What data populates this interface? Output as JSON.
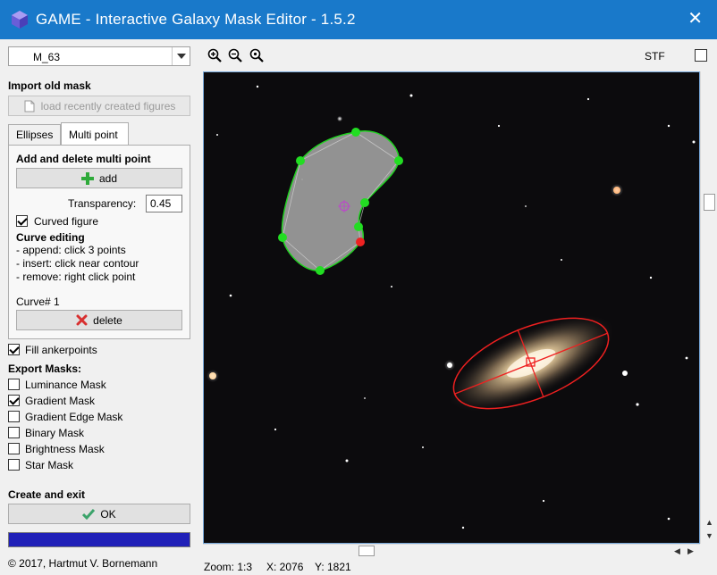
{
  "window": {
    "title": "GAME - Interactive Galaxy Mask Editor -  1.5.2",
    "close_glyph": "✕",
    "title_bar_color": "#1979ca"
  },
  "left_panel": {
    "image_select": {
      "value": "M_63"
    },
    "import_section": {
      "heading": "Import old mask",
      "load_button_label": "load recently created figures"
    },
    "tabs": [
      {
        "label": "Ellipses",
        "active": false
      },
      {
        "label": "Multi point",
        "active": true
      }
    ],
    "multi_point": {
      "heading": "Add and delete multi point",
      "add_button_label": "add",
      "transparency_label": "Transparency:",
      "transparency_value": "0.45",
      "curved_figure_label": "Curved figure",
      "curved_figure_checked": true,
      "curve_editing_heading": "Curve editing",
      "curve_editing_lines": [
        "- append: click 3 points",
        "- insert: click near contour",
        "- remove: right click point"
      ],
      "curve_number": "Curve# 1",
      "delete_button_label": "delete"
    },
    "fill_ankerpoints": {
      "label": "Fill ankerpoints",
      "checked": true
    },
    "export_masks": {
      "heading": "Export Masks:",
      "options": [
        {
          "label": "Luminance Mask",
          "checked": false
        },
        {
          "label": "Gradient Mask",
          "checked": true
        },
        {
          "label": "Gradient Edge Mask",
          "checked": false
        },
        {
          "label": "Binary Mask",
          "checked": false
        },
        {
          "label": "Brightness Mask",
          "checked": false
        },
        {
          "label": "Star Mask",
          "checked": false
        }
      ]
    },
    "create_and_exit": {
      "heading": "Create and exit",
      "ok_button_label": "OK"
    },
    "progress": {
      "fraction": 1.0,
      "color": "#2020b8"
    },
    "copyright": "© 2017, Hartmut V. Bornemann"
  },
  "toolbar": {
    "icons": [
      "zoom-in-icon",
      "zoom-out-icon",
      "zoom-fit-icon"
    ],
    "stf_label": "STF",
    "stf_checked": false
  },
  "canvas": {
    "polygon_fill": "#9a9a9a",
    "anchor_color": "#22dd22",
    "selected_anchor_color": "#ee2222",
    "ellipse_color": "#ee2020"
  },
  "status_bar": {
    "zoom": "Zoom: 1:3",
    "x": "X: 2076",
    "y": "Y: 1821"
  }
}
